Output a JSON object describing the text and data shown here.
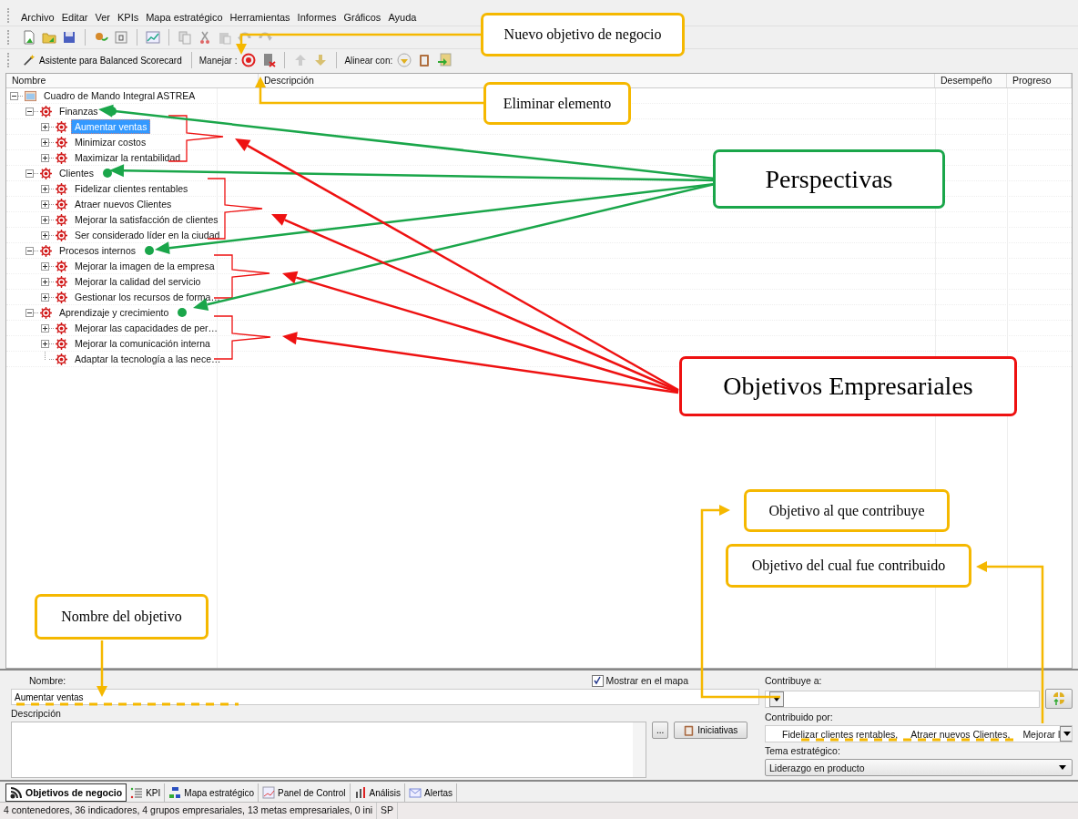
{
  "menu": [
    "Archivo",
    "Editar",
    "Ver",
    "KPIs",
    "Mapa estratégico",
    "Herramientas",
    "Informes",
    "Gráficos",
    "Ayuda"
  ],
  "toolbar": {
    "wizard": "Asistente para Balanced Scorecard",
    "manage_label": "Manejar :",
    "align_label": "Alinear con:"
  },
  "tree": {
    "columns": [
      "Nombre",
      "Descripción",
      "Desempeño",
      "Progreso"
    ],
    "root": {
      "label": "Cuadro de Mando Integral ASTREA",
      "kind": "root",
      "expandable": true,
      "expanded": true,
      "selected": false,
      "marked": false,
      "children": [
        {
          "label": "Finanzas",
          "kind": "perspective",
          "expandable": true,
          "expanded": true,
          "selected": false,
          "marked": true,
          "children": [
            {
              "label": "Aumentar ventas",
              "kind": "objective",
              "expandable": true,
              "expanded": false,
              "selected": true,
              "marked": false
            },
            {
              "label": "Minimizar costos",
              "kind": "objective",
              "expandable": true,
              "expanded": false,
              "selected": false,
              "marked": false
            },
            {
              "label": "Maximizar la rentabilidad",
              "kind": "objective",
              "expandable": true,
              "expanded": false,
              "selected": false,
              "marked": false
            }
          ]
        },
        {
          "label": "Clientes",
          "kind": "perspective",
          "expandable": true,
          "expanded": true,
          "selected": false,
          "marked": true,
          "children": [
            {
              "label": "Fidelizar clientes rentables",
              "kind": "objective",
              "expandable": true,
              "expanded": false,
              "selected": false,
              "marked": false
            },
            {
              "label": "Atraer nuevos Clientes",
              "kind": "objective",
              "expandable": true,
              "expanded": false,
              "selected": false,
              "marked": false
            },
            {
              "label": "Mejorar la satisfacción de clientes",
              "kind": "objective",
              "expandable": true,
              "expanded": false,
              "selected": false,
              "marked": false
            },
            {
              "label": "Ser considerado líder en la ciudad",
              "kind": "objective",
              "expandable": true,
              "expanded": false,
              "selected": false,
              "marked": false
            }
          ]
        },
        {
          "label": "Procesos internos",
          "kind": "perspective",
          "expandable": true,
          "expanded": true,
          "selected": false,
          "marked": true,
          "children": [
            {
              "label": "Mejorar la imagen de la empresa",
              "kind": "objective",
              "expandable": true,
              "expanded": false,
              "selected": false,
              "marked": false
            },
            {
              "label": "Mejorar la calidad del servicio",
              "kind": "objective",
              "expandable": true,
              "expanded": false,
              "selected": false,
              "marked": false
            },
            {
              "label": "Gestionar los recursos de forma…",
              "kind": "objective",
              "expandable": true,
              "expanded": false,
              "selected": false,
              "marked": false
            }
          ]
        },
        {
          "label": "Aprendizaje y crecimiento",
          "kind": "perspective",
          "expandable": true,
          "expanded": true,
          "selected": false,
          "marked": true,
          "children": [
            {
              "label": "Mejorar las capacidades de per…",
              "kind": "objective",
              "expandable": true,
              "expanded": false,
              "selected": false,
              "marked": false
            },
            {
              "label": "Mejorar la comunicación interna",
              "kind": "objective",
              "expandable": true,
              "expanded": false,
              "selected": false,
              "marked": false
            },
            {
              "label": "Adaptar la tecnología a las nece…",
              "kind": "objective",
              "expandable": false,
              "expanded": false,
              "selected": false,
              "marked": false
            }
          ]
        }
      ]
    }
  },
  "form": {
    "name_label": "Nombre:",
    "name_value": "Aumentar ventas",
    "show_on_map": {
      "label": "Mostrar en el mapa",
      "checked": true
    },
    "contributes_label": "Contribuye a:",
    "description_label": "Descripción",
    "ellipsis_button": "...",
    "initiatives_button": "Iniciativas",
    "contributed_label": "Contribuido por:",
    "contributed_items": [
      "Fidelizar clientes rentables,",
      "Atraer nuevos Clientes,",
      "Mejorar l"
    ],
    "theme_label": "Tema estratégico:",
    "theme_value": "Liderazgo en producto"
  },
  "tabs": [
    {
      "label": "Objetivos de negocio",
      "selected": true
    },
    {
      "label": "KPI",
      "selected": false
    },
    {
      "label": "Mapa estratégico",
      "selected": false
    },
    {
      "label": "Panel de Control",
      "selected": false
    },
    {
      "label": "Análisis",
      "selected": false
    },
    {
      "label": "Alertas",
      "selected": false
    }
  ],
  "status_bar": [
    "4 contenedores, 36 indicadores, 4 grupos empresariales, 13 metas empresariales, 0 ini",
    "SP"
  ],
  "annotations": [
    {
      "text": "Nuevo objetivo de negocio",
      "kind": "note"
    },
    {
      "text": "Eliminar elemento",
      "kind": "note"
    },
    {
      "text": "Perspectivas",
      "kind": "perspective"
    },
    {
      "text": "Objetivos Empresariales",
      "kind": "objective"
    },
    {
      "text": "Objetivo al que contribuye",
      "kind": "note"
    },
    {
      "text": "Objetivo del cual fue contribuido",
      "kind": "note"
    },
    {
      "text": "Nombre del objetivo",
      "kind": "note"
    }
  ]
}
